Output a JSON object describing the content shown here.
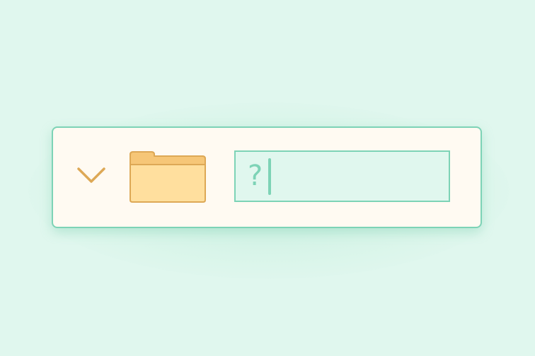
{
  "icons": {
    "expand": "chevron-down-icon",
    "folder": "folder-icon"
  },
  "colors": {
    "background": "#e0f7ee",
    "card_background": "#fffaf2",
    "accent": "#7dd3b6",
    "folder_fill": "#ffdf9e",
    "folder_tab": "#f6c677",
    "folder_stroke": "#dda856",
    "chevron": "#dda856"
  },
  "name_field": {
    "value": "?"
  }
}
